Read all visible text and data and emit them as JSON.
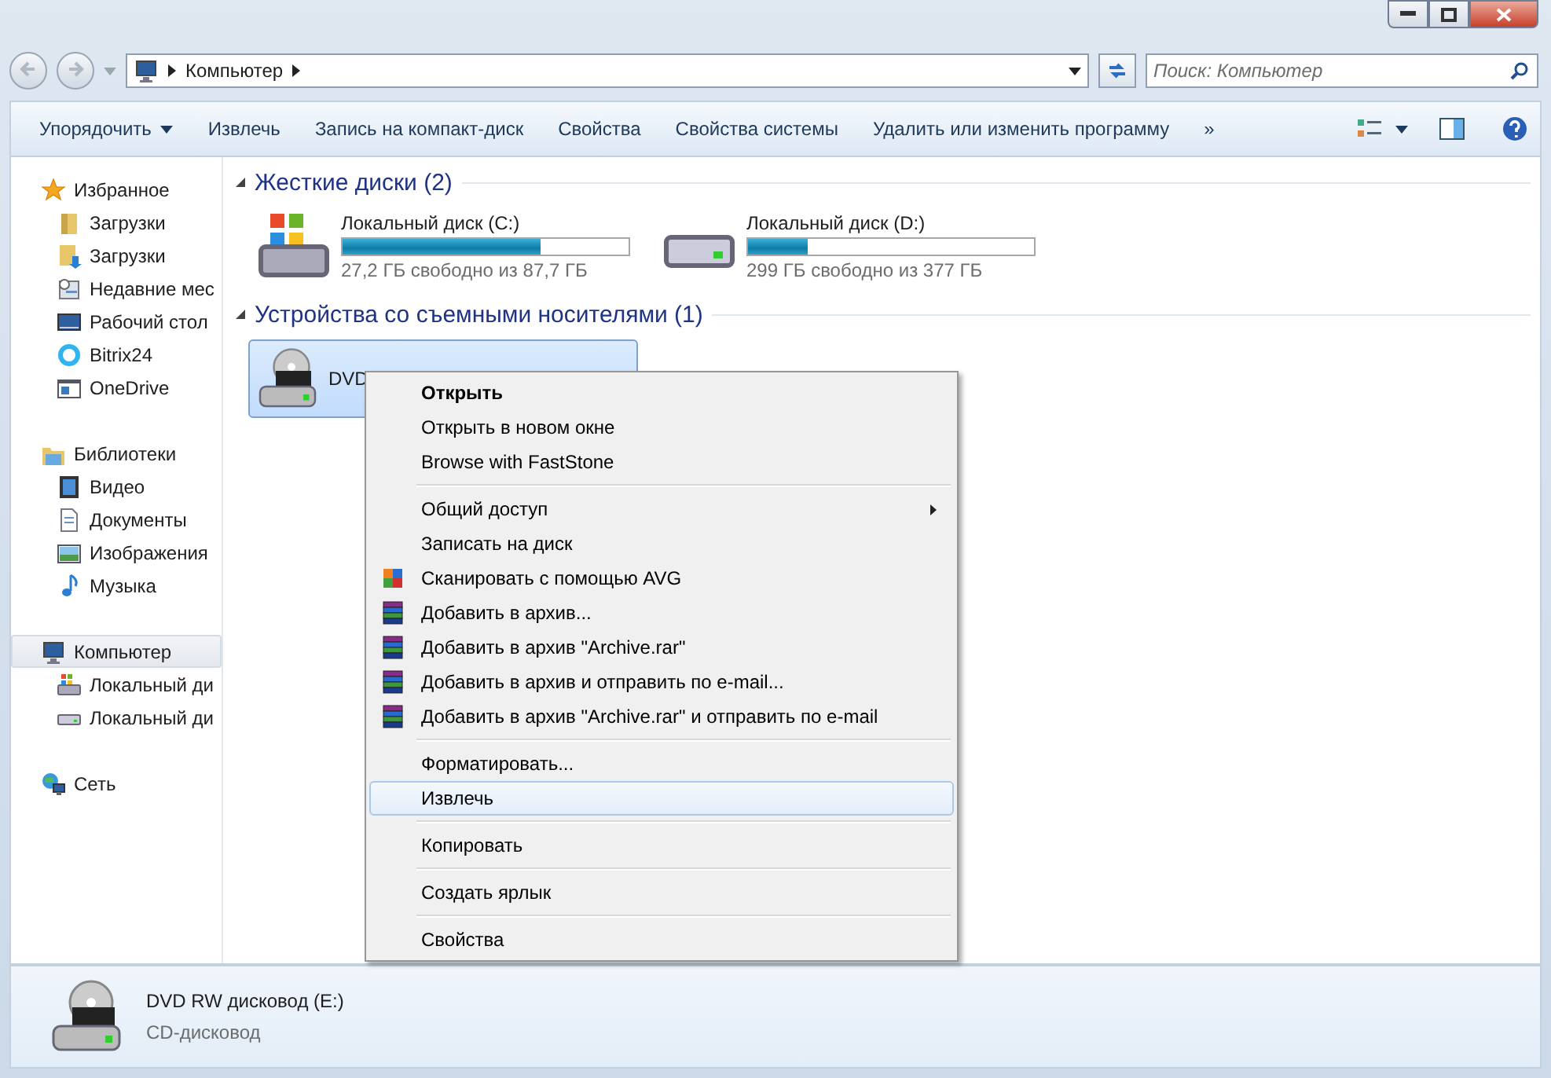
{
  "address": {
    "path": "Компьютер"
  },
  "search": {
    "placeholder": "Поиск: Компьютер"
  },
  "toolbar": [
    {
      "label": "Упорядочить",
      "dropdown": true
    },
    {
      "label": "Извлечь",
      "dropdown": false
    },
    {
      "label": "Запись на компакт-диск",
      "dropdown": false
    },
    {
      "label": "Свойства",
      "dropdown": false
    },
    {
      "label": "Свойства системы",
      "dropdown": false
    },
    {
      "label": "Удалить или изменить программу",
      "dropdown": false
    },
    {
      "label": "»",
      "dropdown": false
    }
  ],
  "sidebar": [
    {
      "label": "Избранное",
      "selected": false,
      "children": [
        {
          "label": "Загрузки",
          "selected": false
        },
        {
          "label": "Загрузки",
          "selected": false
        },
        {
          "label": "Недавние мес",
          "selected": false
        },
        {
          "label": "Рабочий стол",
          "selected": false
        },
        {
          "label": "Bitrix24",
          "selected": false
        },
        {
          "label": "OneDrive",
          "selected": false
        }
      ]
    },
    {
      "label": "Библиотеки",
      "selected": false,
      "children": [
        {
          "label": "Видео",
          "selected": false
        },
        {
          "label": "Документы",
          "selected": false
        },
        {
          "label": "Изображения",
          "selected": false
        },
        {
          "label": "Музыка",
          "selected": false
        }
      ]
    },
    {
      "label": "Компьютер",
      "selected": true,
      "children": [
        {
          "label": "Локальный ди",
          "selected": false
        },
        {
          "label": "Локальный ди",
          "selected": false
        }
      ]
    },
    {
      "label": "Сеть",
      "selected": false
    }
  ],
  "sections": [
    {
      "title": "Жесткие диски (2)",
      "items": [
        {
          "kind": "drive",
          "name": "Локальный диск (C:)",
          "level": 0.69,
          "info": "27,2 ГБ свободно из 87,7 ГБ",
          "selected": false
        },
        {
          "kind": "drive",
          "name": "Локальный диск (D:)",
          "level": 0.21,
          "info": "299 ГБ свободно из 377 ГБ",
          "selected": false
        }
      ]
    },
    {
      "title": "Устройства со съемными носителями (1)",
      "items": [
        {
          "kind": "device",
          "name": "DVD",
          "selected": true
        }
      ]
    }
  ],
  "context_menu": [
    {
      "kind": "item",
      "label": "Открыть",
      "default": true,
      "submenu": false,
      "selected": false
    },
    {
      "kind": "item",
      "label": "Открыть в новом окне",
      "default": false,
      "submenu": false,
      "selected": false
    },
    {
      "kind": "item",
      "label": "Browse with FastStone",
      "default": false,
      "submenu": false,
      "selected": false
    },
    {
      "kind": "separator"
    },
    {
      "kind": "item",
      "label": "Общий доступ",
      "default": false,
      "submenu": true,
      "selected": false
    },
    {
      "kind": "item",
      "label": "Записать на диск",
      "default": false,
      "submenu": false,
      "selected": false
    },
    {
      "kind": "antivirus",
      "label": "Сканировать с помощью AVG",
      "default": false,
      "submenu": false,
      "selected": false
    },
    {
      "kind": "archive",
      "label": "Добавить в архив...",
      "default": false,
      "submenu": false,
      "selected": false
    },
    {
      "kind": "archive",
      "label": "Добавить в архив \"Archive.rar\"",
      "default": false,
      "submenu": false,
      "selected": false
    },
    {
      "kind": "archive",
      "label": "Добавить в архив и отправить по e-mail...",
      "default": false,
      "submenu": false,
      "selected": false
    },
    {
      "kind": "archive",
      "label": "Добавить в архив \"Archive.rar\" и отправить по e-mail",
      "default": false,
      "submenu": false,
      "selected": false
    },
    {
      "kind": "separator"
    },
    {
      "kind": "item",
      "label": "Форматировать...",
      "default": false,
      "submenu": false,
      "selected": false
    },
    {
      "kind": "item",
      "label": "Извлечь",
      "default": false,
      "submenu": false,
      "selected": true
    },
    {
      "kind": "separator"
    },
    {
      "kind": "item",
      "label": "Копировать",
      "default": false,
      "submenu": false,
      "selected": false
    },
    {
      "kind": "separator"
    },
    {
      "kind": "item",
      "label": "Создать ярлык",
      "default": false,
      "submenu": false,
      "selected": false
    },
    {
      "kind": "separator"
    },
    {
      "kind": "item",
      "label": "Свойства",
      "default": false,
      "submenu": false,
      "selected": false
    }
  ],
  "details": {
    "name": "DVD RW дисковод (E:)",
    "type": "CD-дисковод"
  }
}
